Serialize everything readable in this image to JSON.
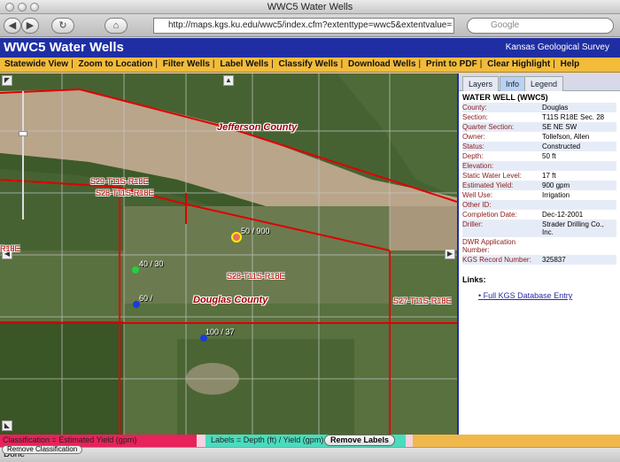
{
  "window": {
    "title": "WWC5 Water Wells"
  },
  "browser": {
    "back_icon": "back-arrow-icon",
    "forward_icon": "forward-arrow-icon",
    "reload_icon": "reload-icon",
    "home_icon": "home-icon",
    "url": "http://maps.kgs.ku.edu/wwc5/index.cfm?extenttype=wwc5&extentvalue=",
    "search_placeholder": "Google",
    "status": "Done"
  },
  "header": {
    "title": "WWC5 Water Wells",
    "org": "Kansas Geological Survey"
  },
  "menu": [
    "Statewide View",
    "Zoom to Location",
    "Filter Wells",
    "Label Wells",
    "Classify Wells",
    "Download Wells",
    "Print to PDF",
    "Clear Highlight",
    "Help"
  ],
  "map": {
    "counties": [
      "Jefferson County",
      "Douglas County"
    ],
    "sections": [
      "S29-T11S-R18E",
      "S28-T11S-R18E",
      "S28-T11S-R18E",
      "S27-T11S-R18E",
      "R18E"
    ],
    "well_labels": [
      "50 / 900",
      "40 / 30",
      "60 / ",
      "100 / 37"
    ]
  },
  "panel": {
    "tabs": [
      "Layers",
      "Info",
      "Legend"
    ],
    "active_tab": "Info",
    "heading": "WATER WELL (WWC5)",
    "rows": [
      {
        "k": "County:",
        "v": "Douglas"
      },
      {
        "k": "Section:",
        "v": "T11S R18E Sec. 28"
      },
      {
        "k": "Quarter Section:",
        "v": "SE NE SW"
      },
      {
        "k": "Owner:",
        "v": "Tollefson, Allen"
      },
      {
        "k": "Status:",
        "v": "Constructed"
      },
      {
        "k": "Depth:",
        "v": "50 ft"
      },
      {
        "k": "Elevation:",
        "v": ""
      },
      {
        "k": "Static Water Level:",
        "v": "17 ft"
      },
      {
        "k": "Estimated Yield:",
        "v": "900 gpm"
      },
      {
        "k": "Well Use:",
        "v": "Irrigation"
      },
      {
        "k": "Other ID:",
        "v": ""
      },
      {
        "k": "Completion Date:",
        "v": "Dec-12-2001"
      },
      {
        "k": "Driller:",
        "v": "Strader Drilling Co., Inc."
      },
      {
        "k": "DWR Application Number:",
        "v": ""
      },
      {
        "k": "KGS Record Number:",
        "v": "325837"
      }
    ],
    "links_heading": "Links:",
    "link": "Full KGS Database Entry"
  },
  "legend": {
    "classification": "Classification = Estimated Yield (gpm)",
    "labels": "Labels = Depth (ft) / Yield (gpm)",
    "remove_labels": "Remove Labels",
    "remove_classification": "Remove Classification"
  },
  "colors": {
    "header": "#1f2fa3",
    "menu": "#f2bb3a",
    "classify": "#e8225a",
    "labels": "#49dcbf"
  }
}
